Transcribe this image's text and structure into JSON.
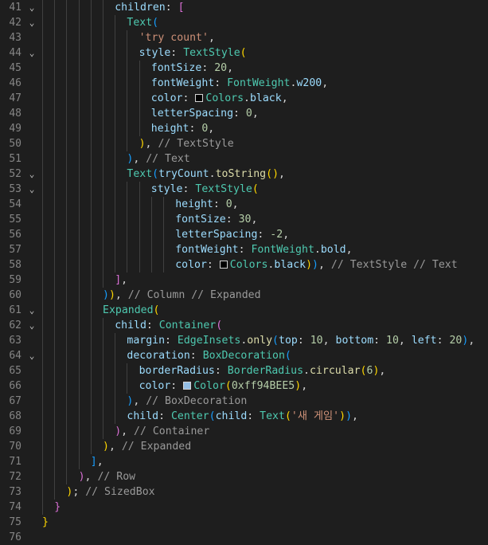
{
  "editor": {
    "colors": {
      "background": "#1e1e1e",
      "line_number": "#858585",
      "property": "#9cdcfe",
      "class": "#4ec9b0",
      "method": "#dcdcaa",
      "string": "#ce9178",
      "number": "#b5cea8",
      "comment": "#9a9a9a",
      "bracket_gold": "#ffd700",
      "bracket_purple": "#da70d6",
      "bracket_blue": "#179fff"
    },
    "lines": [
      {
        "n": "41",
        "fold": true,
        "indent": 6,
        "tokens": [
          [
            "kw",
            "children"
          ],
          [
            "p",
            ": "
          ],
          [
            "b2",
            "["
          ]
        ]
      },
      {
        "n": "42",
        "fold": true,
        "indent": 7,
        "tokens": [
          [
            "fn",
            "Text"
          ],
          [
            "b3",
            "("
          ]
        ]
      },
      {
        "n": "43",
        "fold": false,
        "indent": 8,
        "tokens": [
          [
            "str",
            "'try count'"
          ],
          [
            "p",
            ","
          ]
        ]
      },
      {
        "n": "44",
        "fold": true,
        "indent": 8,
        "tokens": [
          [
            "kw",
            "style"
          ],
          [
            "p",
            ": "
          ],
          [
            "fn",
            "TextStyle"
          ],
          [
            "b1",
            "("
          ]
        ]
      },
      {
        "n": "45",
        "fold": false,
        "indent": 9,
        "tokens": [
          [
            "kw",
            "fontSize"
          ],
          [
            "p",
            ": "
          ],
          [
            "num",
            "20"
          ],
          [
            "p",
            ","
          ]
        ]
      },
      {
        "n": "46",
        "fold": false,
        "indent": 9,
        "tokens": [
          [
            "kw",
            "fontWeight"
          ],
          [
            "p",
            ": "
          ],
          [
            "fn",
            "FontWeight"
          ],
          [
            "p",
            "."
          ],
          [
            "kw",
            "w200"
          ],
          [
            "p",
            ","
          ]
        ]
      },
      {
        "n": "47",
        "fold": false,
        "indent": 9,
        "tokens": [
          [
            "kw",
            "color"
          ],
          [
            "p",
            ": "
          ],
          [
            "sw",
            "#000000"
          ],
          [
            "fn",
            "Colors"
          ],
          [
            "p",
            "."
          ],
          [
            "kw",
            "black"
          ],
          [
            "p",
            ","
          ]
        ]
      },
      {
        "n": "48",
        "fold": false,
        "indent": 9,
        "tokens": [
          [
            "kw",
            "letterSpacing"
          ],
          [
            "p",
            ": "
          ],
          [
            "num",
            "0"
          ],
          [
            "p",
            ","
          ]
        ]
      },
      {
        "n": "49",
        "fold": false,
        "indent": 9,
        "tokens": [
          [
            "kw",
            "height"
          ],
          [
            "p",
            ": "
          ],
          [
            "num",
            "0"
          ],
          [
            "p",
            ","
          ]
        ]
      },
      {
        "n": "50",
        "fold": false,
        "indent": 8,
        "tokens": [
          [
            "b1",
            ")"
          ],
          [
            "p",
            ", "
          ],
          [
            "cm",
            "// TextStyle"
          ]
        ]
      },
      {
        "n": "51",
        "fold": false,
        "indent": 7,
        "tokens": [
          [
            "b3",
            ")"
          ],
          [
            "p",
            ", "
          ],
          [
            "cm",
            "// Text"
          ]
        ]
      },
      {
        "n": "52",
        "fold": true,
        "indent": 7,
        "tokens": [
          [
            "fn",
            "Text"
          ],
          [
            "b3",
            "("
          ],
          [
            "kw",
            "tryCount"
          ],
          [
            "p",
            "."
          ],
          [
            "method",
            "toString"
          ],
          [
            "b1",
            "()"
          ],
          [
            "p",
            ","
          ]
        ]
      },
      {
        "n": "53",
        "fold": true,
        "indent": 9,
        "tokens": [
          [
            "kw",
            "style"
          ],
          [
            "p",
            ": "
          ],
          [
            "fn",
            "TextStyle"
          ],
          [
            "b1",
            "("
          ]
        ]
      },
      {
        "n": "54",
        "fold": false,
        "indent": 11,
        "tokens": [
          [
            "kw",
            "height"
          ],
          [
            "p",
            ": "
          ],
          [
            "num",
            "0"
          ],
          [
            "p",
            ","
          ]
        ]
      },
      {
        "n": "55",
        "fold": false,
        "indent": 11,
        "tokens": [
          [
            "kw",
            "fontSize"
          ],
          [
            "p",
            ": "
          ],
          [
            "num",
            "30"
          ],
          [
            "p",
            ","
          ]
        ]
      },
      {
        "n": "56",
        "fold": false,
        "indent": 11,
        "tokens": [
          [
            "kw",
            "letterSpacing"
          ],
          [
            "p",
            ": "
          ],
          [
            "num",
            "-2"
          ],
          [
            "p",
            ","
          ]
        ]
      },
      {
        "n": "57",
        "fold": false,
        "indent": 11,
        "tokens": [
          [
            "kw",
            "fontWeight"
          ],
          [
            "p",
            ": "
          ],
          [
            "fn",
            "FontWeight"
          ],
          [
            "p",
            "."
          ],
          [
            "kw",
            "bold"
          ],
          [
            "p",
            ","
          ]
        ]
      },
      {
        "n": "58",
        "fold": false,
        "indent": 11,
        "tokens": [
          [
            "kw",
            "color"
          ],
          [
            "p",
            ": "
          ],
          [
            "sw",
            "#000000"
          ],
          [
            "fn",
            "Colors"
          ],
          [
            "p",
            "."
          ],
          [
            "kw",
            "black"
          ],
          [
            "b1",
            ")"
          ],
          [
            "b3",
            ")"
          ],
          [
            "p",
            ", "
          ],
          [
            "cm",
            "// TextStyle // Text"
          ]
        ]
      },
      {
        "n": "59",
        "fold": false,
        "indent": 6,
        "tokens": [
          [
            "b2",
            "]"
          ],
          [
            "p",
            ","
          ]
        ]
      },
      {
        "n": "60",
        "fold": false,
        "indent": 5,
        "tokens": [
          [
            "b3",
            ")"
          ],
          [
            "b1",
            ")"
          ],
          [
            "p",
            ", "
          ],
          [
            "cm",
            "// Column // Expanded"
          ]
        ]
      },
      {
        "n": "61",
        "fold": true,
        "indent": 5,
        "tokens": [
          [
            "fn",
            "Expanded"
          ],
          [
            "b1",
            "("
          ]
        ]
      },
      {
        "n": "62",
        "fold": true,
        "indent": 6,
        "tokens": [
          [
            "kw",
            "child"
          ],
          [
            "p",
            ": "
          ],
          [
            "fn",
            "Container"
          ],
          [
            "b2",
            "("
          ]
        ]
      },
      {
        "n": "63",
        "fold": false,
        "indent": 7,
        "tokens": [
          [
            "kw",
            "margin"
          ],
          [
            "p",
            ": "
          ],
          [
            "fn",
            "EdgeInsets"
          ],
          [
            "p",
            "."
          ],
          [
            "method",
            "only"
          ],
          [
            "b3",
            "("
          ],
          [
            "kw",
            "top"
          ],
          [
            "p",
            ": "
          ],
          [
            "num",
            "10"
          ],
          [
            "p",
            ", "
          ],
          [
            "kw",
            "bottom"
          ],
          [
            "p",
            ": "
          ],
          [
            "num",
            "10"
          ],
          [
            "p",
            ", "
          ],
          [
            "kw",
            "left"
          ],
          [
            "p",
            ": "
          ],
          [
            "num",
            "20"
          ],
          [
            "b3",
            ")"
          ],
          [
            "p",
            ","
          ]
        ]
      },
      {
        "n": "64",
        "fold": true,
        "indent": 7,
        "tokens": [
          [
            "kw",
            "decoration"
          ],
          [
            "p",
            ": "
          ],
          [
            "fn",
            "BoxDecoration"
          ],
          [
            "b3",
            "("
          ]
        ]
      },
      {
        "n": "65",
        "fold": false,
        "indent": 8,
        "tokens": [
          [
            "kw",
            "borderRadius"
          ],
          [
            "p",
            ": "
          ],
          [
            "fn",
            "BorderRadius"
          ],
          [
            "p",
            "."
          ],
          [
            "method",
            "circular"
          ],
          [
            "b1",
            "("
          ],
          [
            "num",
            "6"
          ],
          [
            "b1",
            ")"
          ],
          [
            "p",
            ","
          ]
        ]
      },
      {
        "n": "66",
        "fold": false,
        "indent": 8,
        "tokens": [
          [
            "kw",
            "color"
          ],
          [
            "p",
            ": "
          ],
          [
            "sw",
            "#94BEE5"
          ],
          [
            "fn",
            "Color"
          ],
          [
            "b1",
            "("
          ],
          [
            "num",
            "0xff94BEE5"
          ],
          [
            "b1",
            ")"
          ],
          [
            "p",
            ","
          ]
        ]
      },
      {
        "n": "67",
        "fold": false,
        "indent": 7,
        "tokens": [
          [
            "b3",
            ")"
          ],
          [
            "p",
            ", "
          ],
          [
            "cm",
            "// BoxDecoration"
          ]
        ]
      },
      {
        "n": "68",
        "fold": false,
        "indent": 7,
        "tokens": [
          [
            "kw",
            "child"
          ],
          [
            "p",
            ": "
          ],
          [
            "fn",
            "Center"
          ],
          [
            "b3",
            "("
          ],
          [
            "kw",
            "child"
          ],
          [
            "p",
            ": "
          ],
          [
            "fn",
            "Text"
          ],
          [
            "b1",
            "("
          ],
          [
            "str",
            "'새 게임'"
          ],
          [
            "b1",
            ")"
          ],
          [
            "b3",
            ")"
          ],
          [
            "p",
            ","
          ]
        ]
      },
      {
        "n": "69",
        "fold": false,
        "indent": 6,
        "tokens": [
          [
            "b2",
            ")"
          ],
          [
            "p",
            ", "
          ],
          [
            "cm",
            "// Container"
          ]
        ]
      },
      {
        "n": "70",
        "fold": false,
        "indent": 5,
        "tokens": [
          [
            "b1",
            ")"
          ],
          [
            "p",
            ", "
          ],
          [
            "cm",
            "// Expanded"
          ]
        ]
      },
      {
        "n": "71",
        "fold": false,
        "indent": 4,
        "tokens": [
          [
            "b3",
            "]"
          ],
          [
            "p",
            ","
          ]
        ]
      },
      {
        "n": "72",
        "fold": false,
        "indent": 3,
        "tokens": [
          [
            "b2",
            ")"
          ],
          [
            "p",
            ", "
          ],
          [
            "cm",
            "// Row"
          ]
        ]
      },
      {
        "n": "73",
        "fold": false,
        "indent": 2,
        "tokens": [
          [
            "b1",
            ")"
          ],
          [
            "p",
            "; "
          ],
          [
            "cm",
            "// SizedBox"
          ]
        ]
      },
      {
        "n": "74",
        "fold": false,
        "indent": 1,
        "tokens": [
          [
            "b2",
            "}"
          ]
        ]
      },
      {
        "n": "75",
        "fold": false,
        "indent": 0,
        "tokens": [
          [
            "b1",
            "}"
          ]
        ]
      },
      {
        "n": "76",
        "fold": false,
        "indent": 0,
        "tokens": []
      }
    ]
  }
}
